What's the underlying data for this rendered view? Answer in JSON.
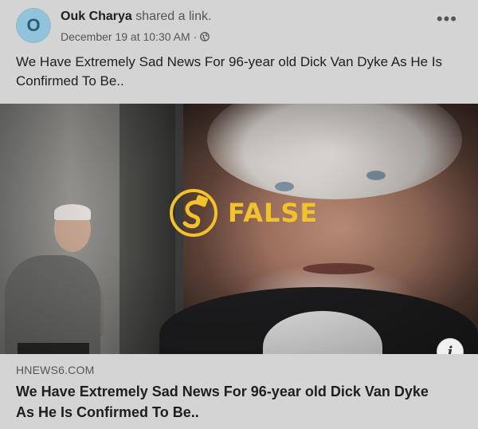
{
  "post": {
    "author": "Ouk Charya",
    "action": "shared a link.",
    "avatar_letter": "O",
    "timestamp": "December 19 at 10:30 AM",
    "separator": "·",
    "audience_icon": "globe-icon",
    "more_icon": "more-options-icon",
    "more_label": "•••",
    "text": "We Have Extremely Sad News For 96-year old Dick Van Dyke As He Is Confirmed To Be.."
  },
  "image": {
    "fact_check_label": "FALSE",
    "fact_check_icon": "fact-check-logo-icon",
    "accent_color": "#f2c22c"
  },
  "link": {
    "domain": "HNEWS6.COM",
    "title": "We Have Extremely Sad News For 96-year old Dick Van Dyke As He Is Confirmed To Be..",
    "info_label": "i"
  }
}
